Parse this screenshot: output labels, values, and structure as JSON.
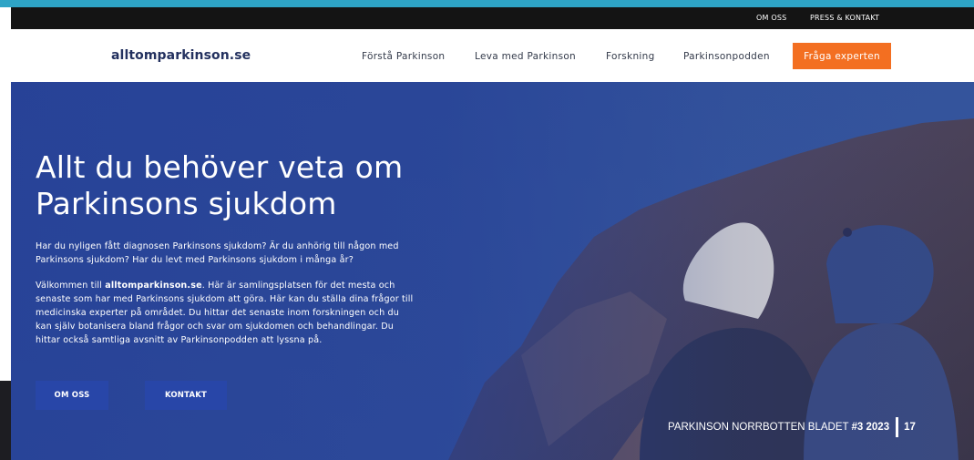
{
  "top_bar": {
    "links": [
      "OM OSS",
      "PRESS & KONTAKT"
    ]
  },
  "navbar": {
    "logo": "alltomparkinson.se",
    "links": [
      "Förstå Parkinson",
      "Leva med Parkinson",
      "Forskning",
      "Parkinsonpodden"
    ],
    "cta": "Fråga experten"
  },
  "hero": {
    "title_line1": "Allt du behöver veta om",
    "title_line2": "Parkinsons sjukdom",
    "intro_line1": "Har du nyligen fått diagnosen Parkinsons sjukdom? Är du anhörig till någon med",
    "intro_line2": "Parkinsons sjukdom? Har du levt med Parkinsons sjukdom i många år?",
    "body_prefix": "Välkommen till ",
    "body_site": "alltomparkinson.se",
    "body_line1_rest": ". Här är samlingsplatsen för det mesta och",
    "body_line2": "senaste som har med Parkinsons sjukdom att göra. Här kan du ställa dina frågor till",
    "body_line3": "medicinska experter på området. Du hittar det senaste inom forskningen och du",
    "body_line4": "kan själv botanisera bland frågor och svar om sjukdomen och behandlingar. Du",
    "body_line5": "hittar också samtliga avsnitt av Parkinsonpodden att lyssna på.",
    "buttons": [
      "OM OSS",
      "KONTAKT"
    ]
  },
  "footer": {
    "publication": "PARKINSON NORRBOTTEN BLADET",
    "issue": "#3 2023",
    "page": "17"
  },
  "colors": {
    "accent_strip": "#2ea4c6",
    "cta": "#f36f21",
    "hero_overlay": "#243e96",
    "button": "#2846a8",
    "logo": "#23315f"
  }
}
